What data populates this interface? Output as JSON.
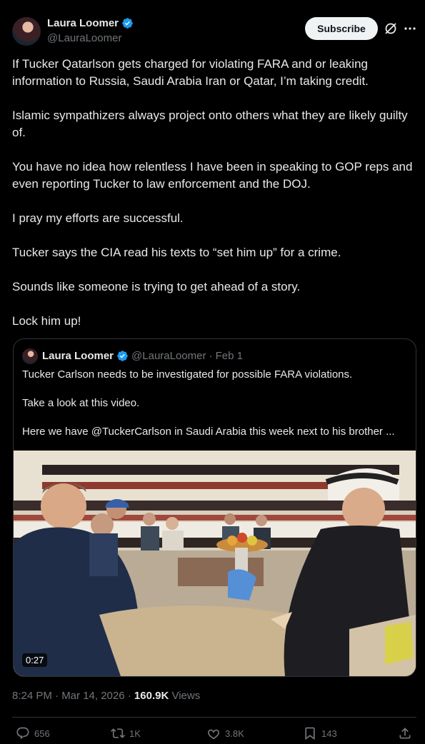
{
  "author": {
    "name": "Laura Loomer",
    "handle": "@LauraLoomer"
  },
  "subscribe_label": "Subscribe",
  "tweet_paragraphs": [
    "If Tucker Qatarlson gets charged for violating FARA and or leaking information to Russia, Saudi Arabia Iran or Qatar, I’m taking credit.",
    "Islamic sympathizers always project onto others what they are likely guilty of.",
    "You have no idea how relentless I have been in speaking to GOP reps and even reporting Tucker to law enforcement and the DOJ.",
    "I pray my efforts are successful.",
    "Tucker says the CIA read his texts to “set him up” for a crime.",
    "Sounds like someone is trying to get ahead of a story.",
    "Lock him up!"
  ],
  "quote": {
    "name": "Laura Loomer",
    "handle": "@LauraLoomer",
    "date": "· Feb 1",
    "paragraphs": [
      "Tucker Carlson needs to be investigated for possible FARA violations.",
      "Take a look at this video.",
      "Here we have @TuckerCarlson in Saudi Arabia this week next to his brother ..."
    ],
    "video_duration": "0:27"
  },
  "timestamp": "8:24 PM · Mar 14, 2026 · ",
  "views_count": "160.9K",
  "views_label": " Views",
  "actions": {
    "replies": "656",
    "reposts": "1K",
    "likes": "3.8K",
    "bookmarks": "143"
  },
  "colors": {
    "background": "#000000",
    "text": "#e7e9ea",
    "muted": "#71767b",
    "verified": "#1d9bf0",
    "border": "#2f3336"
  }
}
